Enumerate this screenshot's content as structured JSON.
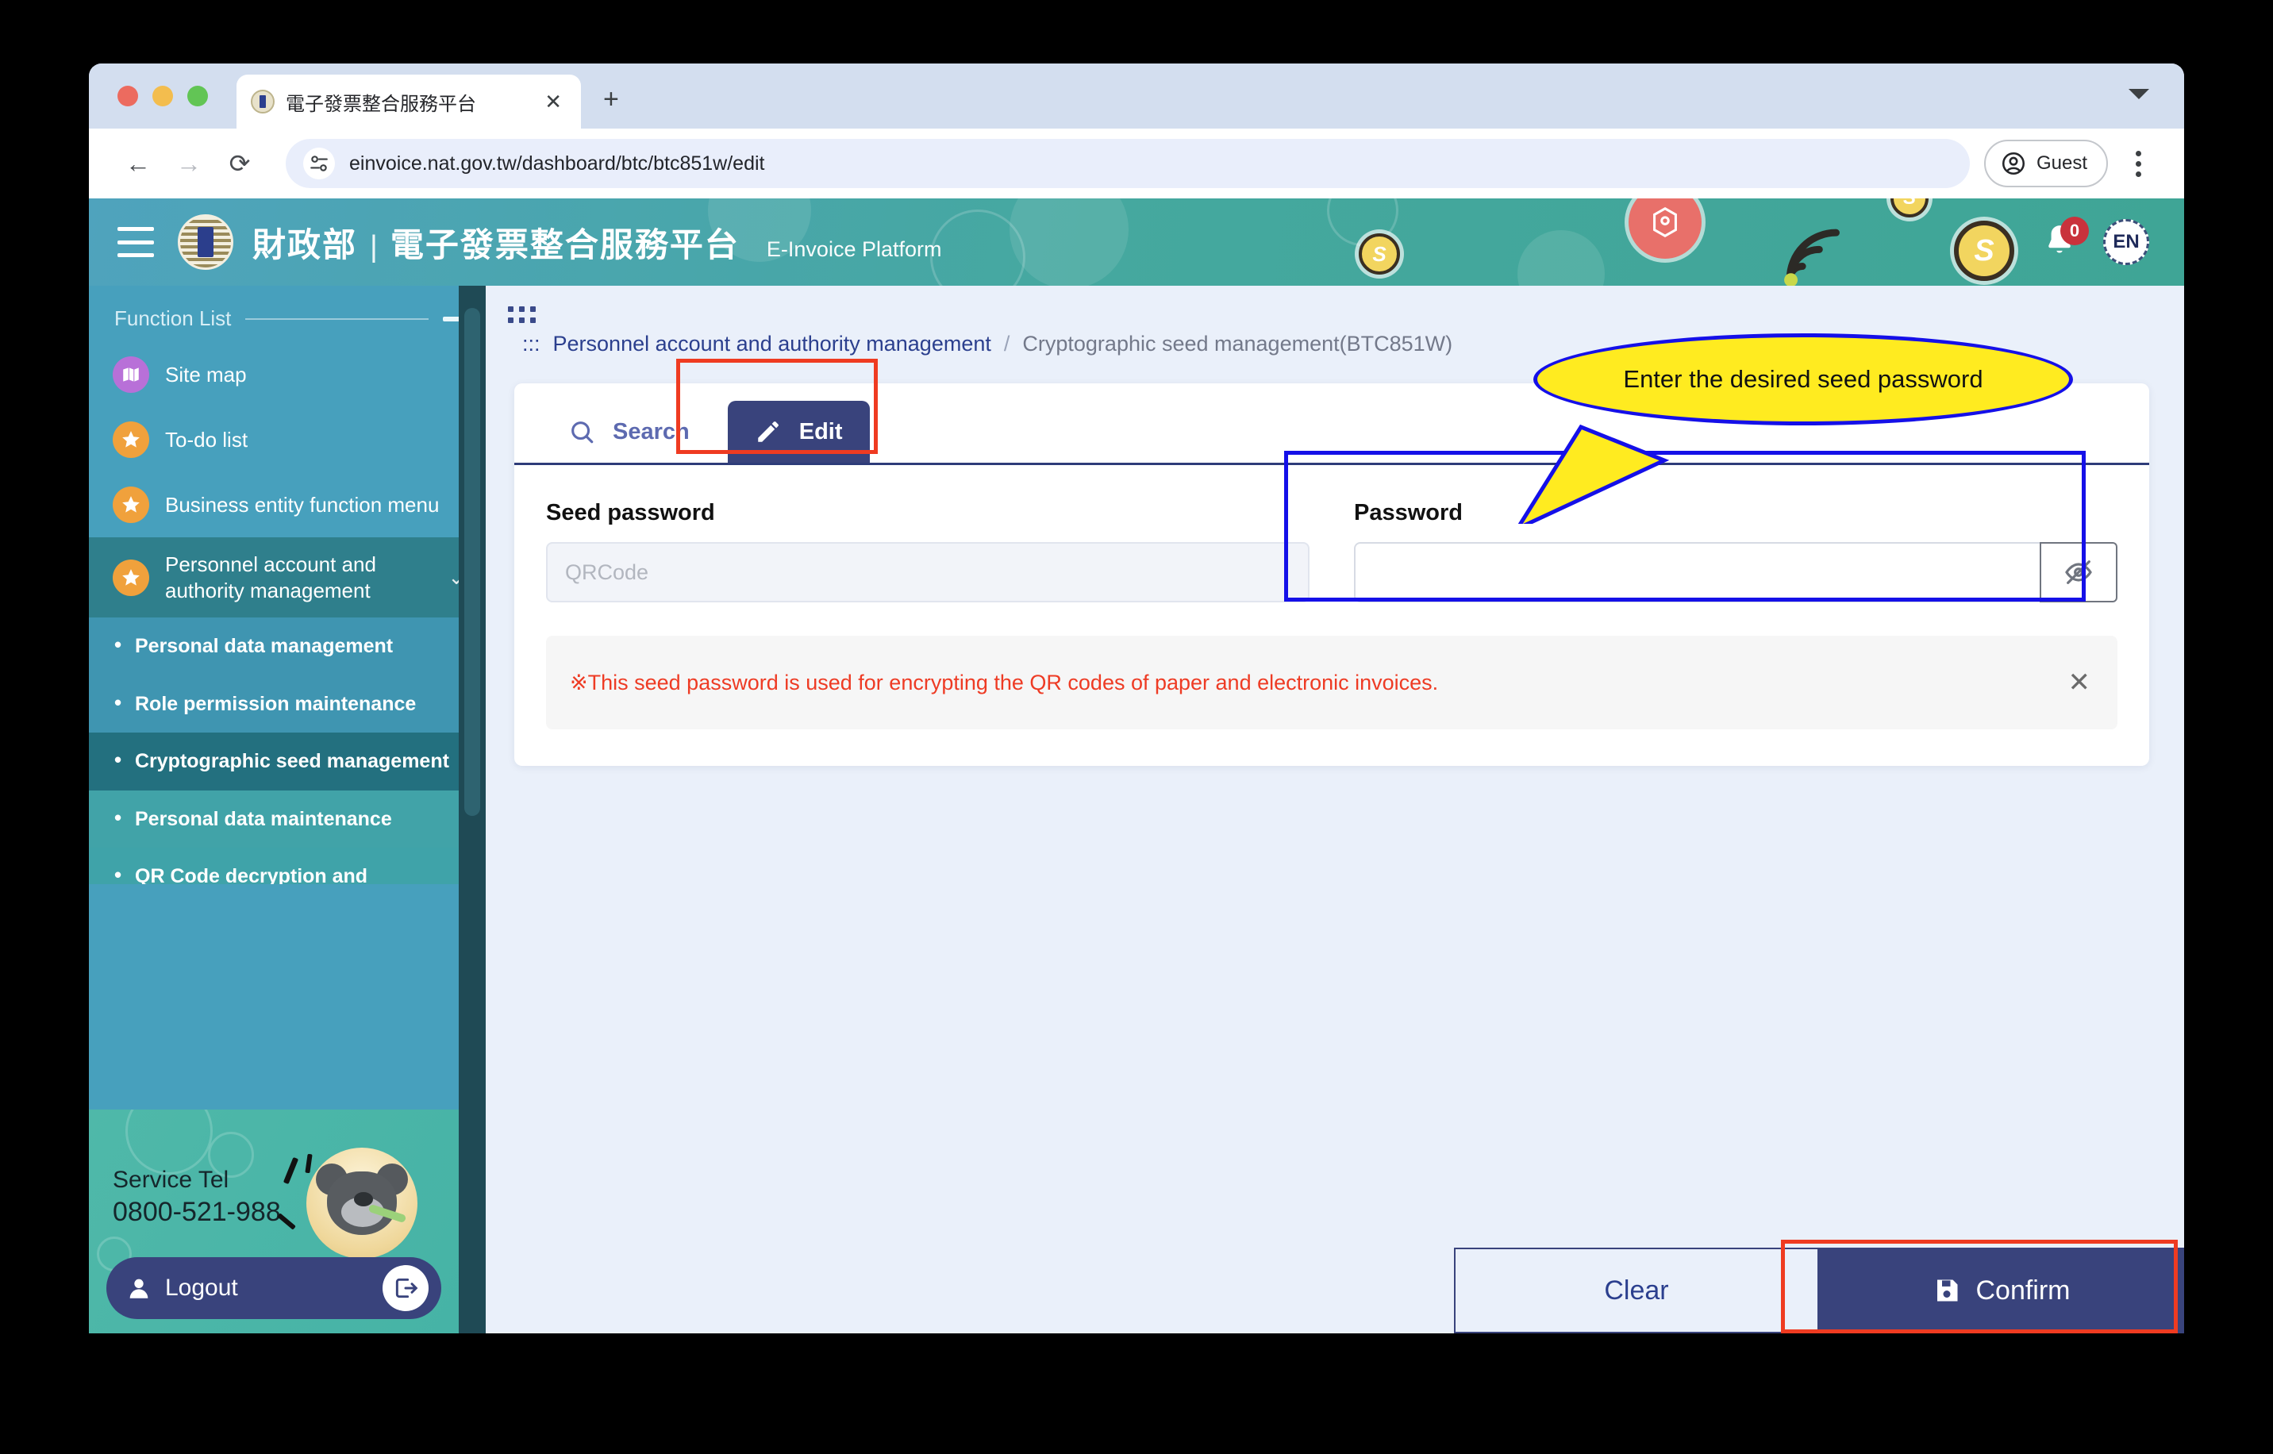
{
  "browser": {
    "tab": {
      "title": "電子發票整合服務平台",
      "favicon": "gov-seal-icon",
      "close": "✕"
    },
    "newtab_label": "+",
    "url": "einvoice.nat.gov.tw/dashboard/btc/btc851w/edit",
    "back": "←",
    "forward": "→",
    "reload": "⟳",
    "profile_label": "Guest"
  },
  "site_header": {
    "ministry": "財政部",
    "divider": "|",
    "platform_cn": "電子發票整合服務平台",
    "platform_en": "E-Invoice Platform",
    "notification_count": "0",
    "language": "EN"
  },
  "sidebar": {
    "title": "Function List",
    "items": [
      {
        "label": "Site map",
        "icon": "map-icon",
        "icon_color": "purple"
      },
      {
        "label": "To-do list",
        "icon": "star-icon",
        "icon_color": "orange"
      },
      {
        "label": "Business entity function menu",
        "icon": "star-icon",
        "icon_color": "orange",
        "chevron": "›"
      },
      {
        "label": "Personnel account and authority management",
        "icon": "star-icon",
        "icon_color": "orange",
        "chevron": "⌄"
      }
    ],
    "sub_items": [
      {
        "label": "Personal data management"
      },
      {
        "label": "Role permission maintenance"
      },
      {
        "label": "Cryptographic seed management"
      },
      {
        "label": "Personal data maintenance"
      },
      {
        "label": "QR Code decryption and"
      }
    ],
    "service": {
      "label": "Service Tel",
      "phone": "0800-521-988"
    },
    "logout": {
      "label": "Logout"
    }
  },
  "breadcrumb": {
    "prefix": ":::",
    "parent": "Personnel account and authority management",
    "separator": "/",
    "current": "Cryptographic seed management(BTC851W)"
  },
  "tabs": [
    {
      "label": "Search",
      "icon": "search-icon",
      "active": false
    },
    {
      "label": "Edit",
      "icon": "pencil-icon",
      "active": true
    }
  ],
  "form": {
    "seed_password": {
      "label": "Seed password",
      "value": "",
      "placeholder": "QRCode"
    },
    "password": {
      "label": "Password",
      "value": "",
      "placeholder": "",
      "toggle_icon": "eye-off-icon"
    }
  },
  "notice": {
    "text": "※This seed password is used for encrypting the QR codes of paper and electronic invoices.",
    "close": "✕",
    "color": "#ee3b24"
  },
  "callout": {
    "text": "Enter the desired seed password"
  },
  "actions": {
    "clear": "Clear",
    "confirm": "Confirm",
    "confirm_icon": "save-icon"
  }
}
